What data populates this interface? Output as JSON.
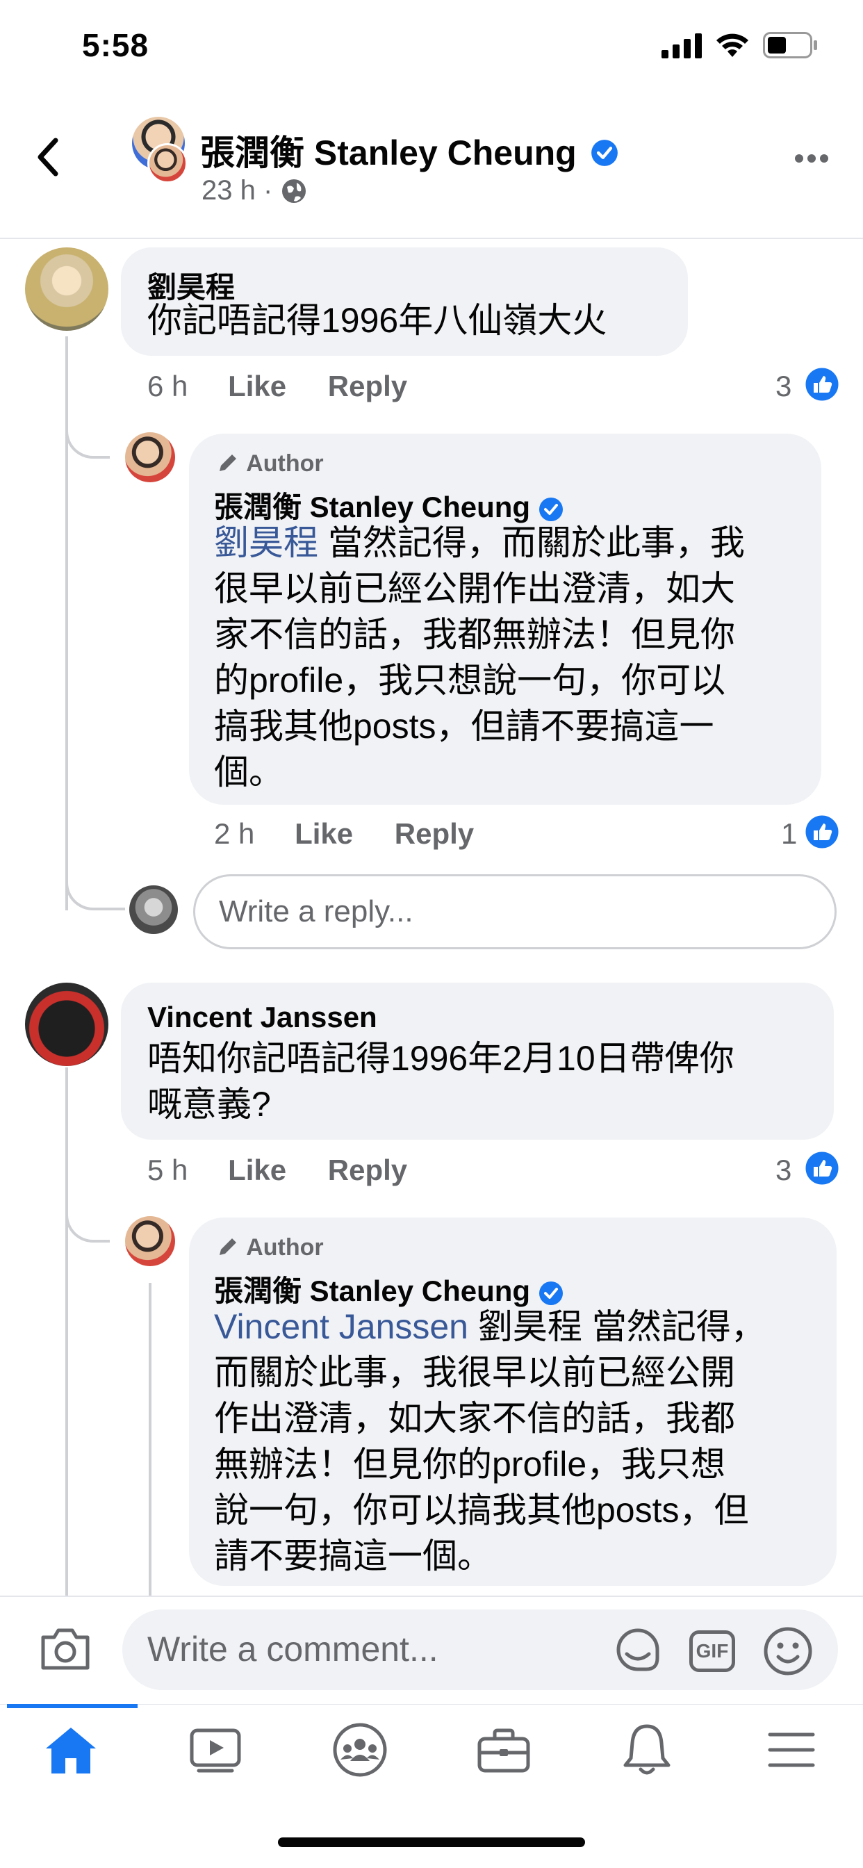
{
  "status_bar": {
    "time": "5:58"
  },
  "header": {
    "title": "張潤衡 Stanley Cheung",
    "time": "23 h",
    "dot": "·"
  },
  "comments": [
    {
      "author": "劉昊程",
      "text": "你記唔記得1996年八仙嶺大火",
      "time": "6 h",
      "like_label": "Like",
      "reply_label": "Reply",
      "reactions": "3",
      "reply": {
        "badge": "Author",
        "author": "張潤衡 Stanley Cheung",
        "mention": "劉昊程",
        "text_lines": [
          "當然記得，而關於此事，我",
          "很早以前已經公開作出澄清，如大",
          "家不信的話，我都無辦法！但見你",
          "的profile，我只想說一句，你可以",
          "搞我其他posts，但請不要搞這一",
          "個。"
        ],
        "time": "2 h",
        "like_label": "Like",
        "reply_label": "Reply",
        "reactions": "1"
      },
      "reply_input_placeholder": "Write a reply..."
    },
    {
      "author": "Vincent Janssen",
      "text_lines": [
        "唔知你記唔記得1996年2月10日帶俾你",
        "嘅意義?"
      ],
      "time": "5 h",
      "like_label": "Like",
      "reply_label": "Reply",
      "reactions": "3",
      "reply": {
        "badge": "Author",
        "author": "張潤衡 Stanley Cheung",
        "mention": "Vincent Janssen",
        "text_lines": [
          "劉昊程 當然記得，",
          "而關於此事，我很早以前已經公開",
          "作出澄清，如大家不信的話，我都",
          "無辦法！但見你的profile，我只想",
          "說一句，你可以搞我其他posts，但",
          "請不要搞這一個。"
        ]
      }
    }
  ],
  "composer": {
    "placeholder": "Write a comment...",
    "gif_label": "GIF"
  },
  "tabs": [
    "home-icon",
    "watch-icon",
    "groups-icon",
    "marketplace-icon",
    "notifications-icon",
    "menu-icon"
  ],
  "colors": {
    "accent": "#1877f2",
    "link": "#385898",
    "bubble": "#f0f2f5",
    "muted": "#65676b"
  }
}
